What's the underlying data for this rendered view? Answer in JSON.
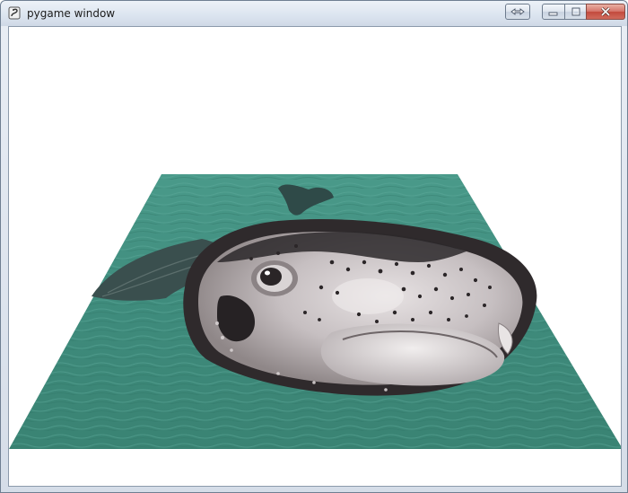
{
  "window": {
    "title": "pygame window",
    "icon": "pygame-snake-icon",
    "buttons": {
      "restore": "restore-icon",
      "minimize": "minimize-icon",
      "maximize": "maximize-icon",
      "close": "close-icon"
    }
  },
  "scene": {
    "description_icon": "pufferfish-on-water-texture",
    "colors": {
      "water": "#3f8f80",
      "fish_body": "#c9c3c4",
      "fish_dark": "#2e2a2c",
      "background": "#ffffff"
    }
  }
}
